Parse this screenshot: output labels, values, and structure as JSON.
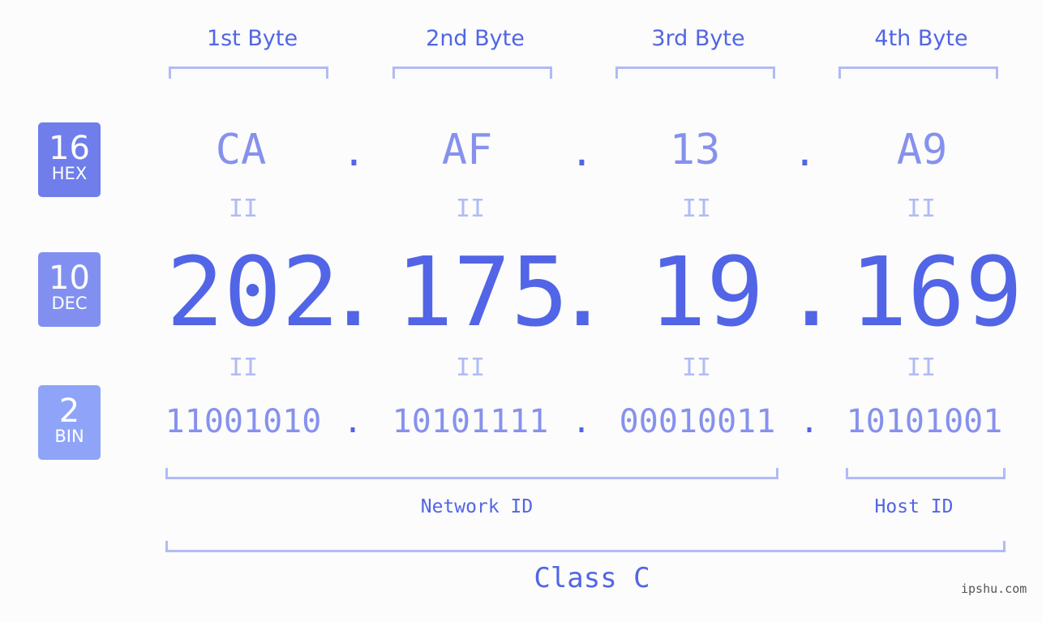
{
  "bytes": [
    {
      "label": "1st Byte",
      "hex": "CA",
      "dec": "202",
      "bin": "11001010"
    },
    {
      "label": "2nd Byte",
      "hex": "AF",
      "dec": "175",
      "bin": "10101111"
    },
    {
      "label": "3rd Byte",
      "hex": "13",
      "dec": "19",
      "bin": "00010011"
    },
    {
      "label": "4th Byte",
      "hex": "A9",
      "dec": "169",
      "bin": "10101001"
    }
  ],
  "badges": {
    "hex": {
      "num": "16",
      "label": "HEX",
      "color": "#6f7eea"
    },
    "dec": {
      "num": "10",
      "label": "DEC",
      "color": "#8190f0"
    },
    "bin": {
      "num": "2",
      "label": "BIN",
      "color": "#8fa4f8"
    }
  },
  "separator": ".",
  "equals": "II",
  "network_id_label": "Network ID",
  "host_id_label": "Host ID",
  "class_label": "Class C",
  "watermark": "ipshu.com"
}
